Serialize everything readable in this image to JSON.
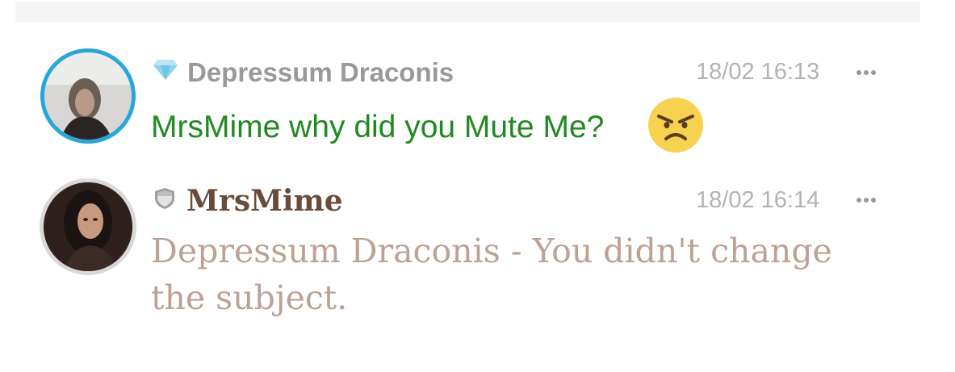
{
  "messages": [
    {
      "username": "Depressum Draconis",
      "badge_icon": "diamond-icon",
      "timestamp": "18/02 16:13",
      "text": "MrsMime why did you Mute Me?",
      "emoji": "angry-face-emoji",
      "text_color": "#1f8a1f",
      "avatar_ring_color": "#27a6d8"
    },
    {
      "username": "MrsMime",
      "badge_icon": "shield-icon",
      "timestamp": "18/02 16:14",
      "text": "Depressum Draconis - You didn't change the subject.",
      "text_color": "#bda194",
      "avatar_ring_color": "#d9d9d9"
    }
  ],
  "more_icon": "more-options-icon"
}
